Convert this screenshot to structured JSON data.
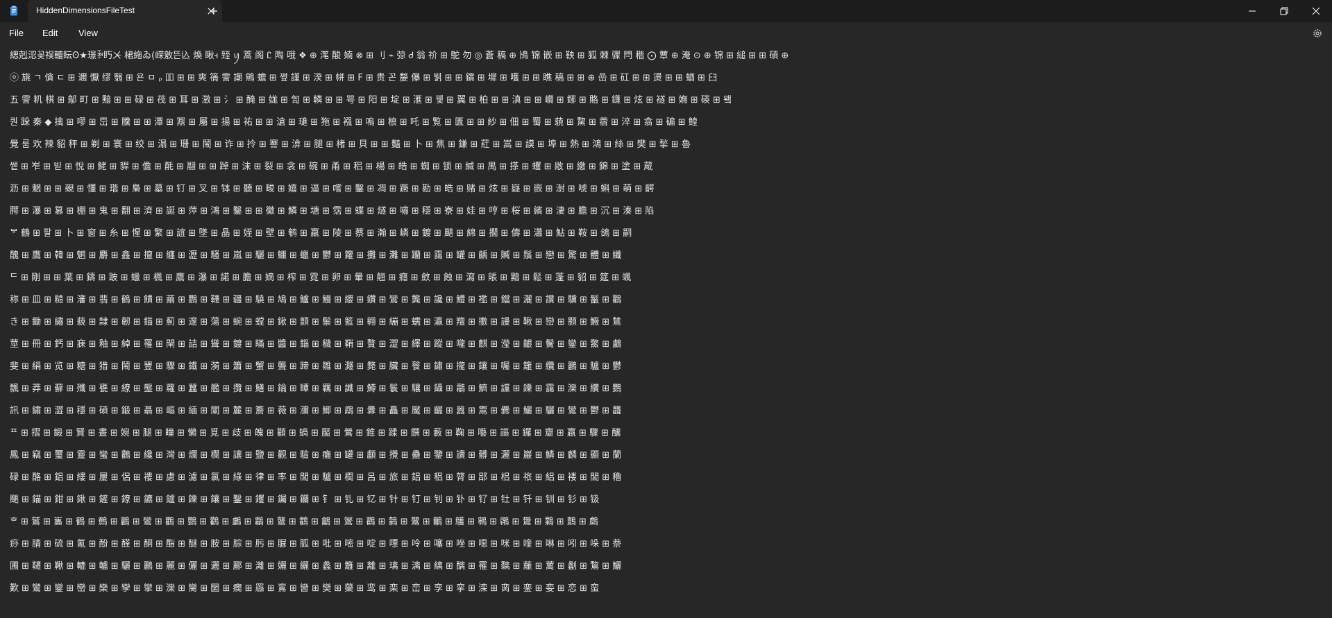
{
  "window": {
    "tab_title": "HiddenDimensionsFileTest",
    "new_tab_symbol": "+"
  },
  "menu": {
    "file": "File",
    "edit": "Edit",
    "view": "View"
  },
  "icons": {
    "app": "notepad-icon",
    "close_tab": "close-icon",
    "new_tab": "plus-icon",
    "minimize": "minimize-icon",
    "maximize": "maximize-icon",
    "close_window": "close-icon",
    "settings": "gear-icon"
  },
  "colors": {
    "background": "#272727",
    "titlebar": "#1c1c1c",
    "text": "#e6e6e6"
  },
  "editor": {
    "lines": [
      "緦剋涊꽂祦轆眃ʘ★璟ꋘ䀎ㆨ 桾絁ゐ(嵘敫뜬兦 煥 瞅ꟶ 臸 ꪗ 蒿 阁 Ꮭ 陶 哦 ❖ ⊕ 滗 酸 婻 ⊗ ⊞ 刂 ⌁ 弶 Ꮷ 翁 祄 ⊞ 鴕  勿   ◎ 蒼 稿 ⊕ 鳪 锦 嵌 ⊞ 鞅 ⊞ 狐 棘 骤 閂 稭 ⨀ 蕈 ⊕ 淹 ⊙ ⊕ 锦 ⊞ 縋 ⊞ ⊞ 碩 ⊕",
      "ⓞ 旐 ㄱ 僋 ㄷ ⊞ 邇 懨 缪 翳 ⊞ 욘 ㅁ ᵨ 吅 ⊞ ⊞ 爽 篟 霅 謿 鵷 蟾 ⊞ 쪞 謹 ⊞ 湀 ⊞ 帡 ⊞ F ⊞ 贵 꼰 嫠 儤 ⊞ 뷁 ⊞ ⊞ 鑜 ⊞ 墀 ⊞ 嚄 ⊞ ⊞ 瞧 稿 ⊞ ⊞ ⊕ 嵒 ⊞ 矼 ⊞ ⊞ 燙 ⊞ ⊞ 蝤 ⊞ 臼",
      "五 霅 籶 棋 ⊞ 鄥 町 ⊞ 黯 ⊞ ⊞ 碌 ⊞ 茷 ⊞ 耳 ⊞ 澂 ⊞ 氵 ⊞ 醃 ⊞ 娏 ⊞ 訇 ⊞ 轔 ⊞ ⊞ 咢 ⊞ 阳 ⊞ 埞 ⊞ 滙 ⊞ 뀇 ⊞ 翼 ⊞ 柏 ⊞ ⊞ 滇 ⊞ ⊞ 巑 ⊞ 鋣 ⊞ 賂 ⊞ 鑝 ⊞ 炫 ⊞ 襚 ⊞ 嫵 ⊞ 碤 ⊞ 뫸",
      "퀀 跺 秦 ◆ 擒 ⊞ 嘐 ⊞ 岊 ⊞ 黱 ⊞ ⊞ 潭 ⊞ 鼏 ⊞ 屬 ⊞ 揚 ⊞ 祐 ⊞ ⊞ 滄 ⊞ 璡 ⊞ 狏 ⊞ 襁 ⊞ 嗚 ⊞ 桹 ⊞ 吒 ⊞ 覧 ⊞ 匱 ⊞ ⊞ 紗 ⊞ 佃 ⊞ 蜀 ⊞ 藐 ⊞ 黧 ⊞ 蓿 ⊞ 淬 ⊞ 翕 ⊞ 碥 ⊞ 鳇",
      "覺 룸 欢 辣 貂 秤 ⊞ 剃 ⊞ 寰 ⊞ 绞 ⊞ 溻 ⊞ 珊 ⊞ 鬧 ⊞ 诈 ⊞ 拎 ⊞ 謇 ⊞ 渰 ⊞ 腿 ⊞ 楮 ⊞ 貝 ⊞ ⊞ 豔 ⊞ 卜 ⊞ 焦 ⊞ 鎌 ⊞ 葒 ⊞ 嵩 ⊞ 謨 ⊞ 埠 ⊞ 熱 ⊞ 鴻 ⊞ 絲 ⊞ 樊 ⊞ 揫 ⊞ 魯",
      "쌭 ⊞ 岝 ⊞ 빋 ⊞ 悅 ⊞ 鮱 ⊞ 貋 ⊞ 儋 ⊞ 酕 ⊞ 翮 ⊞ ⊞ 踔 ⊞ 沫 ⊞ 裂 ⊞ 衾 ⊞ 碗 ⊞ 甬 ⊞ 稆 ⊞ 楊 ⊞ 皓 ⊞ 蜘 ⊞ 锁 ⊞ 緘 ⊞ 禺 ⊞ 搽 ⊞ 蠼 ⊞ 敞 ⊞ 繳 ⊞ 錦 ⊞ 塗 ⊞ 蔵",
      "沥 ⊞ 魍 ⊞ ⊞ 覡 ⊞ 懂 ⊞ 瑎 ⊞ 梟 ⊞ 墓 ⊞ 钉 ⊞ 叉 ⊞ 钵 ⊞ 聽 ⊞ 畯 ⊞ 嬉 ⊞ 逼 ⊞ 嚐 ⊞ 鑿 ⊞ 凋 ⊞ 蹶 ⊞ 勘 ⊞ 皓 ⊞ 赌 ⊞ 炫 ⊞ 嶷 ⊞ 嵌 ⊞ 澍 ⊞ 唬 ⊞ 蝌 ⊞ 萌 ⊞ 齶",
      "腭 ⊞ 瀑 ⊞ 篡 ⊞ 棚 ⊞ 鬼 ⊞ 翻 ⊞ 濟 ⊞ 誕 ⊞ 萍 ⊞ 鴻 ⊞ 鑿 ⊞ ⊞ 黴 ⊞ 鱗 ⊞ 塘 ⊞ 霑 ⊞ 蝶 ⊞ 燧 ⊞ 嘯 ⊞ 穩 ⊞ 寮 ⊞ 娃 ⊞ 哼 ⊞ 桜 ⊞ 繽 ⊞ 淒 ⊞ 膽 ⊞ 沉 ⊞ 湊 ⊞ 陷",
      "ᄫ 鶴 ⊞ 팔 ⊞ 卜 ⊞ 窗 ⊞ 糸 ⊞ 惺 ⊞ 繁 ⊞ 誼 ⊞ 墜 ⊞ 晶 ⊞ 姪 ⊞ 壁 ⊞ 鹌 ⊞ 羸 ⊞ 陵 ⊞ 蔡 ⊞ 瀚 ⊞ 嶙 ⊞ 鍍 ⊞ 颶 ⊞ 綿 ⊞ 擱 ⊞ 儔 ⊞ 瀟 ⊞ 鮎 ⊞ 鞍 ⊞ 鴿 ⊞ 嗣",
      "醜 ⊞ 鷹 ⊞ 韓 ⊞ 魍 ⊞ 麝 ⊞ 鑫 ⊞ 擅 ⊞ 纏 ⊞ 瀝 ⊞ 騷 ⊞ 嵐 ⊞ 驪 ⊞ 鱷 ⊞ 蠟 ⊞ 鬱 ⊞ 籮 ⊞ 攤 ⊞ 灘 ⊞ 躪 ⊞ 靄 ⊞ 罐 ⊞ 齲 ⊞ 贓 ⊞ 鬚 ⊞ 戀 ⊞ 驚 ⊞ 體 ⊞ 纖",
      "ᄃ ⊞ 剛 ⊞ ⊞ 葉 ⊞ 鑄 ⊞ 跛 ⊞ 蠟 ⊞ 楓 ⊞ 鷹 ⊞ 瀑 ⊞ 諾 ⊞ 膽 ⊞ 嫡 ⊞ 榨 ⊞ 霓 ⊞ 卵 ⊞ 暈 ⊞ 翹 ⊞ 癮 ⊞ 斂 ⊞ 蝕 ⊞ 瀉 ⊞ 賬 ⊞ 黯 ⊞ 鬆 ⊞ 蓬 ⊞ 貂 ⊞ 筵 ⊞ 颯",
      "称 ⊞ 皿 ⊞ 糙 ⊞ 瀋 ⊞ 翡 ⊞ 鶴 ⊞ 饋 ⊞ 繭 ⊞ 鸚 ⊞ 韆 ⊞ 疆 ⊞ 驍 ⊞ 鳩 ⊞ 鱸 ⊞ 鰻 ⊞ 纓 ⊞ 鑽 ⊞ 鸞 ⊞ 龔 ⊞ 讒 ⊞ 鱧 ⊞ 襤 ⊞ 鐺 ⊞ 灑 ⊞ 讚 ⊞ 驥 ⊞ 鬣 ⊞ 鸛",
      "き ⊞ 鋤 ⊞ 繡 ⊞ 藐 ⊞ 隸 ⊞ 韌 ⊞ 錨 ⊞ 薊 ⊞ 邃 ⊞ 蕩 ⊞ 蜿 ⊞ 螳 ⊞ 鍬 ⊞ 顫 ⊞ 鬃 ⊞ 籃 ⊞ 翱 ⊞ 繃 ⊞ 蠕 ⊞ 瀛 ⊞ 羶 ⊞ 擻 ⊞ 謾 ⊞ 鞦 ⊞ 巒 ⊞ 顥 ⊞ 鱖 ⊞ 鷥",
      "莖 ⊞ 冊 ⊞ 鈣 ⊞ 寐 ⊞ 釉 ⊞ 綽 ⊞ 罹 ⊞ 閘 ⊞ 詰 ⊞ 聳 ⊞ 鍍 ⊞ 瞞 ⊞ 醬 ⊞ 錙 ⊞ 穢 ⊞ 鞘 ⊞ 贅 ⊞ 澀 ⊞ 繹 ⊞ 蹤 ⊞ 嚨 ⊞ 麒 ⊞ 瀅 ⊞ 齦 ⊞ 鬢 ⊞ 鑾 ⊞ 鱉 ⊞ 鸕",
      "斐 ⊞ 絹 ⊞ 览 ⊞ 糖 ⊞ 猎 ⊞ 鬧 ⊞ 豐 ⊞ 驟 ⊞ 鐵 ⊞ 漪 ⊞ 簫 ⊞ 蟹 ⊞ 聾 ⊞ 蹄 ⊞ 雛 ⊞ 濺 ⊞ 斃 ⊞ 臟 ⊞ 餮 ⊞ 鏽 ⊞ 攏 ⊞ 鑲 ⊞ 囑 ⊞ 籬 ⊞ 纜 ⊞ 鸝 ⊞ 驢 ⊞ 鬱",
      "飄 ⊞ 莽 ⊞ 蘚 ⊞ 殲 ⊞ 甕 ⊞ 繚 ⊞ 壟 ⊞ 蘿 ⊞ 蠶 ⊞ 艦 ⊞ 攬 ⊞ 鱔 ⊞ 鑰 ⊞ 罈 ⊞ 羈 ⊞ 讖 ⊞ 鱒 ⊞ 鬟 ⊞ 驤 ⊞ 鑷 ⊞ 鸘 ⊞ 鱭 ⊞ 讜 ⊞ 鑠 ⊞ 靄 ⊞ 灤 ⊞ 纘 ⊞ 鸚",
      "訊 ⊞ 鏽 ⊞ 澀 ⊞ 穩 ⊞ 碩 ⊞ 鍛 ⊞ 聶 ⊞ 嶇 ⊞ 緬 ⊞ 闡 ⊞ 麓 ⊞ 簷 ⊞ 薇 ⊞ 瀰 ⊞ 鯽 ⊞ 鵡 ⊞ 釁 ⊞ 矗 ⊞ 魘 ⊞ 齷 ⊞ 囂 ⊞ 鬻 ⊞ 爨 ⊞ 鱺 ⊞ 驪 ⊞ 鸞 ⊞ 鬱 ⊞ 龘",
      "ᄑ ⊞ 摺 ⊞ 鍛 ⊞ 賢 ⊞ 晝 ⊞ 婉 ⊞ 腿 ⊞ 瞳 ⊞ 懶 ⊞ 覓 ⊞ 歧 ⊞ 魄 ⊞ 顴 ⊞ 蝸 ⊞ 靨 ⊞ 鶯 ⊞ 錐 ⊞ 蹂 ⊞ 饌 ⊞ 藪 ⊞ 鞠 ⊞ 囈 ⊞ 謳 ⊞ 鑼 ⊞ 齏 ⊞ 羸 ⊞ 驟 ⊞ 釀",
      "鳳 ⊞ 竊 ⊞ 璽 ⊞ 靈 ⊞ 蠻 ⊞ 鸛 ⊞ 纔 ⊞ 灣 ⊞ 爛 ⊞ 欄 ⊞ 讓 ⊞ 鹽 ⊞ 觀 ⊞ 驗 ⊞ 癱 ⊞ 罐 ⊞ 顱 ⊞ 攪 ⊞ 蠱 ⊞ 鑒 ⊞ 讀 ⊞ 髒 ⊞ 灑 ⊞ 巖 ⊞ 鱗 ⊞ 麟 ⊞ 顯 ⊞ 蘭",
      "碌 ⊞ 酪 ⊞ 鋁 ⊞ 縷 ⊞ 屢 ⊞ 侶 ⊞ 褸 ⊞ 慮 ⊞ 濾 ⊞ 氯 ⊞ 綠 ⊞ 律 ⊞ 率 ⊞ 閭 ⊞ 驢 ⊞ 櫚 ⊞ 呂 ⊞ 旅 ⊞ 鋁 ⊞ 稆 ⊞ 膂 ⊞ 郘 ⊞ 梠 ⊞ 祣 ⊞ 絽 ⊞ 褛 ⊞ 閭 ⊞ 穭",
      "颶 ⊞ 錨 ⊞ 鉗 ⊞ 鍬 ⊞ 鏟 ⊞ 鐐 ⊞ 鑣 ⊞ 鑪 ⊞ 鑠 ⊞ 鑲 ⊞ 鑿 ⊞ 钁 ⊞ 钃 ⊞ 钄 ⊞ 钅 ⊞ 钆 ⊞ 钇 ⊞ 针 ⊞ 钉 ⊞ 钊 ⊞ 钋 ⊞ 钌 ⊞ 钍 ⊞ 钎 ⊞ 钏 ⊞ 钐 ⊞ 钑",
      "ᄒ ⊞ 鷲 ⊞ 巂 ⊞ 鶴 ⊞ 鷯 ⊞ 鸝 ⊞ 鸞 ⊞ 鸜 ⊞ 鸚 ⊞ 鸛 ⊞ 鸕 ⊞ 鸘 ⊞ 鸗 ⊞ 鸖 ⊞ 鸙 ⊞ 鸑 ⊞ 鸐 ⊞ 鸏 ⊞ 鸎 ⊞ 鸍 ⊞ 鸌 ⊞ 鸋 ⊞ 鸊 ⊞ 鸉 ⊞ 鸈 ⊞ 鸇 ⊞ 鸆",
      "痧 ⊞ 腈 ⊞ 硫 ⊞ 氰 ⊞ 酚 ⊞ 醛 ⊞ 酮 ⊞ 酯 ⊞ 醚 ⊞ 胺 ⊞ 腙 ⊞ 肟 ⊞ 脲 ⊞ 胍 ⊞ 吡 ⊞ 嘧 ⊞ 啶 ⊞ 嘌 ⊞ 呤 ⊞ 噻 ⊞ 唑 ⊞ 噁 ⊞ 咪 ⊞ 喹 ⊞ 啉 ⊞ 吲 ⊞ 哚 ⊞ 萘",
      "圃 ⊞ 韆 ⊞ 鞦 ⊞ 轆 ⊞ 轤 ⊞ 驪 ⊞ 鸝 ⊞ 麗 ⊞ 儷 ⊞ 邐 ⊞ 酈 ⊞ 灕 ⊞ 孋 ⊞ 纚 ⊞ 蠡 ⊞ 籬 ⊞ 離 ⊞ 璃 ⊞ 漓 ⊞ 縭 ⊞ 醨 ⊞ 罹 ⊞ 黐 ⊞ 蘺 ⊞ 蓠 ⊞ 劙 ⊞ 鵹 ⊞ 鱺",
      "歎 ⊞ 鸞 ⊞ 鑾 ⊞ 巒 ⊞ 欒 ⊞ 孿 ⊞ 攣 ⊞ 灤 ⊞ 臠 ⊞ 圞 ⊞ 癵 ⊞ 羉 ⊞ 鵉 ⊞ 曫 ⊞ 奱 ⊞ 虊 ⊞ 鸾 ⊞ 栾 ⊞ 峦 ⊞ 孪 ⊞ 挛 ⊞ 滦 ⊞ 脔 ⊞ 銮 ⊞ 娈 ⊞ 恋 ⊞ 蛮"
    ]
  }
}
